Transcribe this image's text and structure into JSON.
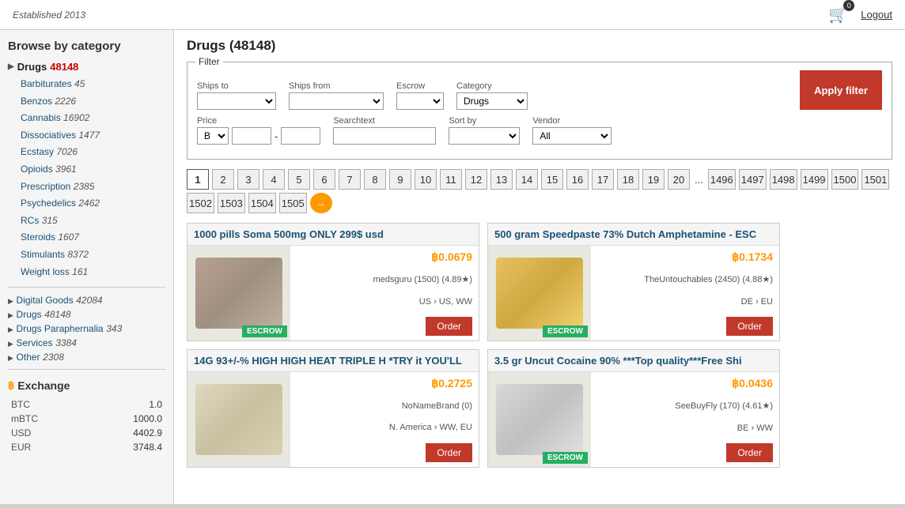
{
  "topbar": {
    "established": "Established 2013",
    "cart_count": "0",
    "logout_label": "Logout"
  },
  "sidebar": {
    "title": "Browse by category",
    "main_cat": {
      "name": "Drugs",
      "count": "48148",
      "subcategories": [
        {
          "name": "Barbiturates",
          "count": "45"
        },
        {
          "name": "Benzos",
          "count": "2226"
        },
        {
          "name": "Cannabis",
          "count": "16902"
        },
        {
          "name": "Dissociatives",
          "count": "1477"
        },
        {
          "name": "Ecstasy",
          "count": "7026"
        },
        {
          "name": "Opioids",
          "count": "3961"
        },
        {
          "name": "Prescription",
          "count": "2385"
        },
        {
          "name": "Psychedelics",
          "count": "2462"
        },
        {
          "name": "RCs",
          "count": "315"
        },
        {
          "name": "Steroids",
          "count": "1607"
        },
        {
          "name": "Stimulants",
          "count": "8372"
        },
        {
          "name": "Weight loss",
          "count": "161"
        }
      ]
    },
    "other_cats": [
      {
        "name": "Digital Goods",
        "count": "42084"
      },
      {
        "name": "Drugs",
        "count": "48148"
      },
      {
        "name": "Drugs Paraphernalia",
        "count": "343"
      },
      {
        "name": "Services",
        "count": "3384"
      },
      {
        "name": "Other",
        "count": "2308"
      }
    ],
    "exchange_title": "Exchange",
    "exchange_rows": [
      {
        "label": "BTC",
        "value": "1.0"
      },
      {
        "label": "mBTC",
        "value": "1000.0"
      },
      {
        "label": "USD",
        "value": "4402.9"
      },
      {
        "label": "EUR",
        "value": "3748.4"
      }
    ]
  },
  "content": {
    "page_title": "Drugs (48148)",
    "filter": {
      "legend": "Filter",
      "ships_to_label": "Ships to",
      "ships_from_label": "Ships from",
      "escrow_label": "Escrow",
      "category_label": "Category",
      "category_value": "Drugs",
      "price_label": "Price",
      "price_currency": "B",
      "searchtext_label": "Searchtext",
      "sort_by_label": "Sort by",
      "vendor_label": "Vendor",
      "vendor_value": "All",
      "apply_label": "Apply filter"
    },
    "pagination": {
      "pages": [
        "1",
        "2",
        "3",
        "4",
        "5",
        "6",
        "7",
        "8",
        "9",
        "10",
        "11",
        "12",
        "13",
        "14",
        "15",
        "16",
        "17",
        "18",
        "19",
        "20",
        "...",
        "1496",
        "1497",
        "1498",
        "1499",
        "1500",
        "1501",
        "1502",
        "1503",
        "1504",
        "1505"
      ],
      "active": "1"
    },
    "products": [
      {
        "title": "1000 pills Soma 500mg ONLY 299$ usd",
        "price": "฿0.0679",
        "vendor": "medsguru (1500) (4.89★)",
        "ships": "US › US, WW",
        "escrow": "ESCROW",
        "order_label": "Order",
        "img_type": "pill"
      },
      {
        "title": "500 gram Speedpaste 73% Dutch Amphetamine - ESC",
        "price": "฿0.1734",
        "vendor": "TheUntouchables (2450) (4.88★)",
        "ships": "DE › EU",
        "escrow": "ESCROW",
        "order_label": "Order",
        "img_type": "amber"
      },
      {
        "title": "14G 93+/-% HIGH HIGH HEAT TRIPLE H *TRY it YOU'LL",
        "price": "฿0.2725",
        "vendor": "NoNameBrand (0)",
        "ships": "N. America › WW, EU",
        "escrow": "",
        "order_label": "Order",
        "img_type": "powder"
      },
      {
        "title": "3.5 gr Uncut Cocaine 90% ***Top quality***Free Shi",
        "price": "฿0.0436",
        "vendor": "SeeBuyFly (170) (4.61★)",
        "ships": "BE › WW",
        "escrow": "ESCROW",
        "order_label": "Order",
        "img_type": "cocaine"
      }
    ]
  }
}
